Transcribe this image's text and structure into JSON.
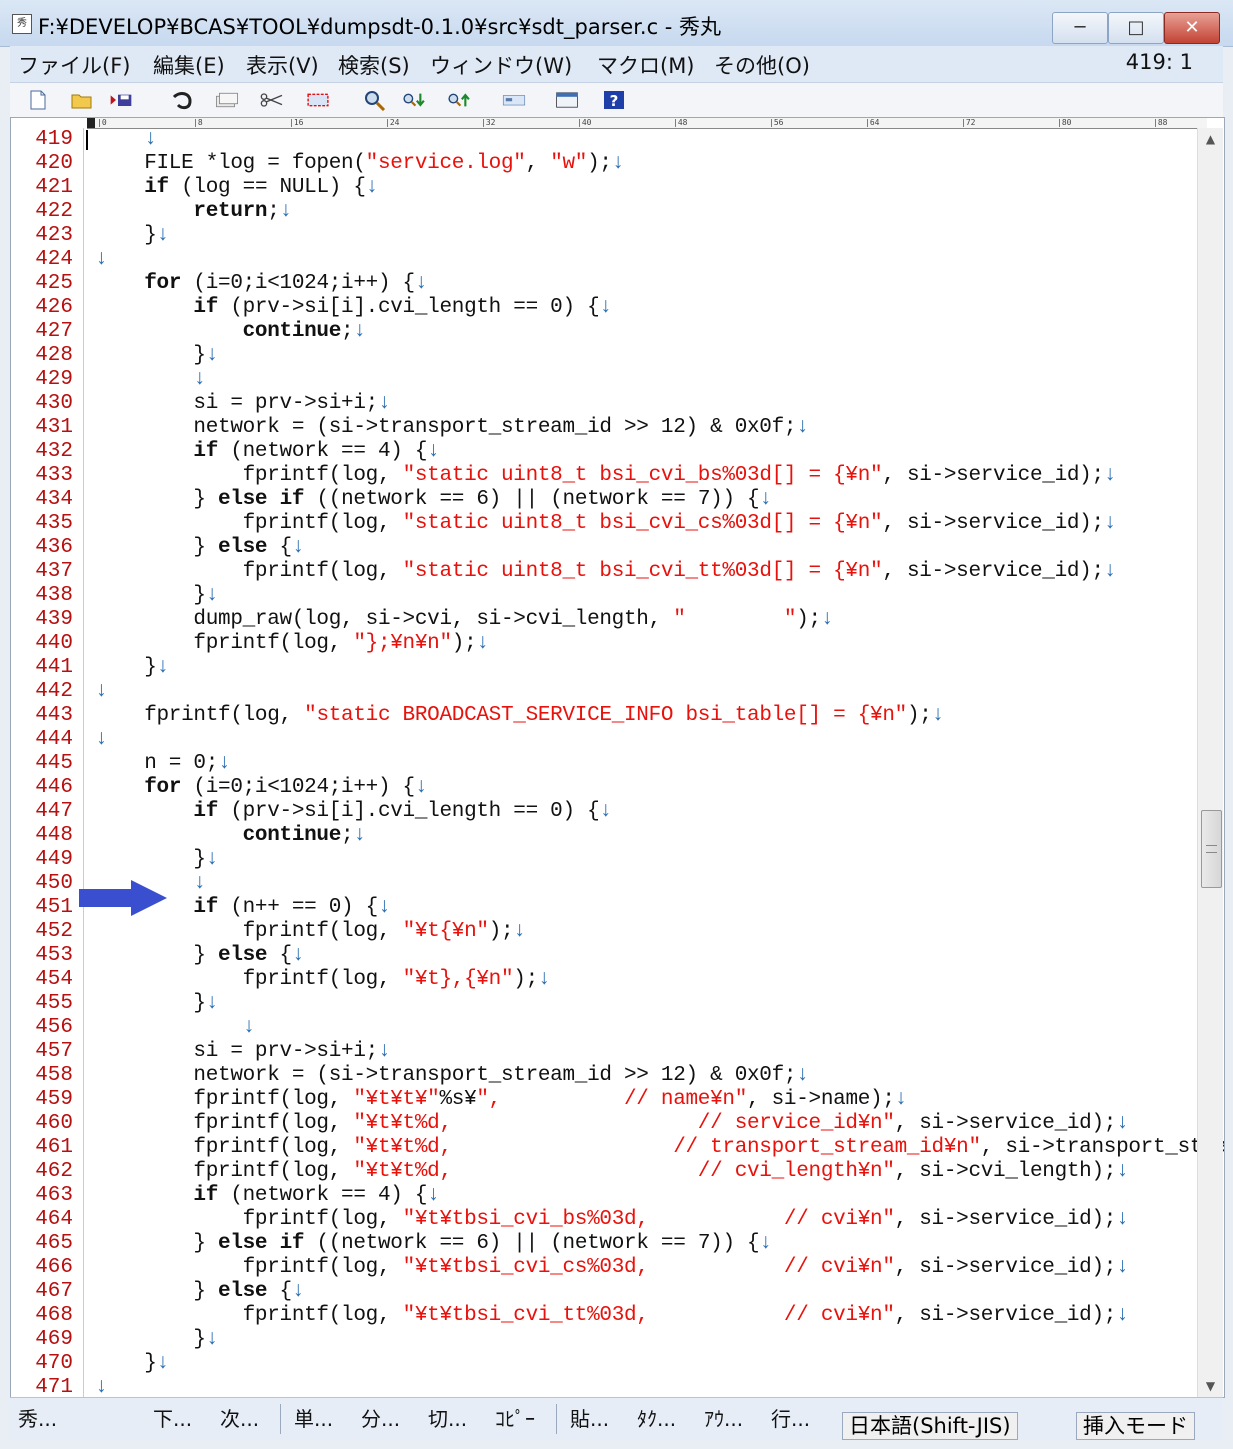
{
  "window": {
    "title": "F:¥DEVELOP¥BCAS¥TOOL¥dumpsdt-0.1.0¥src¥sdt_parser.c  - 秀丸",
    "app_icon_text": "秀",
    "minimize_glyph": "─",
    "maximize_glyph": "□",
    "close_glyph": "✕"
  },
  "menu": {
    "items": [
      "ファイル(F)",
      "編集(E)",
      "表示(V)",
      "検索(S)",
      "ウィンドウ(W)",
      "マクロ(M)",
      "その他(O)"
    ],
    "cursor_position": "419: 1"
  },
  "toolbar": {
    "icons": [
      "new-file-icon",
      "open-folder-icon",
      "save-icon",
      "undo-icon",
      "copy-icon",
      "cut-icon",
      "select-icon",
      "search-icon",
      "search-down-icon",
      "search-up-icon",
      "grep-icon",
      "window-icon",
      "help-icon"
    ]
  },
  "ruler": {
    "marks": [
      "0",
      "8",
      "16",
      "24",
      "32",
      "40",
      "48",
      "56",
      "64",
      "72",
      "80",
      "88"
    ]
  },
  "editor": {
    "lines": [
      {
        "n": "419",
        "t": "    ↓"
      },
      {
        "n": "420",
        "t": "    FILE *log = fopen(\"service.log\", \"w\");↓"
      },
      {
        "n": "421",
        "t": "    if (log == NULL) {↓"
      },
      {
        "n": "422",
        "t": "        return;↓"
      },
      {
        "n": "423",
        "t": "    }↓"
      },
      {
        "n": "424",
        "t": "↓"
      },
      {
        "n": "425",
        "t": "    for (i=0;i<1024;i++) {↓"
      },
      {
        "n": "426",
        "t": "        if (prv->si[i].cvi_length == 0) {↓"
      },
      {
        "n": "427",
        "t": "            continue;↓"
      },
      {
        "n": "428",
        "t": "        }↓"
      },
      {
        "n": "429",
        "t": "        ↓"
      },
      {
        "n": "430",
        "t": "        si = prv->si+i;↓"
      },
      {
        "n": "431",
        "t": "        network = (si->transport_stream_id >> 12) & 0x0f;↓"
      },
      {
        "n": "432",
        "t": "        if (network == 4) {↓"
      },
      {
        "n": "433",
        "t": "            fprintf(log, \"static uint8_t bsi_cvi_bs%03d[] = {¥n\", si->service_id);↓"
      },
      {
        "n": "434",
        "t": "        } else if ((network == 6) || (network == 7)) {↓"
      },
      {
        "n": "435",
        "t": "            fprintf(log, \"static uint8_t bsi_cvi_cs%03d[] = {¥n\", si->service_id);↓"
      },
      {
        "n": "436",
        "t": "        } else {↓"
      },
      {
        "n": "437",
        "t": "            fprintf(log, \"static uint8_t bsi_cvi_tt%03d[] = {¥n\", si->service_id);↓"
      },
      {
        "n": "438",
        "t": "        }↓"
      },
      {
        "n": "439",
        "t": "        dump_raw(log, si->cvi, si->cvi_length, \"        \");↓"
      },
      {
        "n": "440",
        "t": "        fprintf(log, \"};¥n¥n\");↓"
      },
      {
        "n": "441",
        "t": "    }↓"
      },
      {
        "n": "442",
        "t": "↓"
      },
      {
        "n": "443",
        "t": "    fprintf(log, \"static BROADCAST_SERVICE_INFO bsi_table[] = {¥n\");↓"
      },
      {
        "n": "444",
        "t": "↓"
      },
      {
        "n": "445",
        "t": "    n = 0;↓"
      },
      {
        "n": "446",
        "t": "    for (i=0;i<1024;i++) {↓"
      },
      {
        "n": "447",
        "t": "        if (prv->si[i].cvi_length == 0) {↓"
      },
      {
        "n": "448",
        "t": "            continue;↓"
      },
      {
        "n": "449",
        "t": "        }↓"
      },
      {
        "n": "450",
        "t": "        ↓"
      },
      {
        "n": "451",
        "t": "        if (n++ == 0) {↓"
      },
      {
        "n": "452",
        "t": "            fprintf(log, \"¥t{¥n\");↓"
      },
      {
        "n": "453",
        "t": "        } else {↓"
      },
      {
        "n": "454",
        "t": "            fprintf(log, \"¥t},{¥n\");↓"
      },
      {
        "n": "455",
        "t": "        }↓"
      },
      {
        "n": "456",
        "t": "            ↓"
      },
      {
        "n": "457",
        "t": "        si = prv->si+i;↓"
      },
      {
        "n": "458",
        "t": "        network = (si->transport_stream_id >> 12) & 0x0f;↓"
      },
      {
        "n": "459",
        "t": "        fprintf(log, \"¥t¥t¥\"%s¥\",          // name¥n\", si->name);↓"
      },
      {
        "n": "460",
        "t": "        fprintf(log, \"¥t¥t%d,                    // service_id¥n\", si->service_id);↓"
      },
      {
        "n": "461",
        "t": "        fprintf(log, \"¥t¥t%d,                  // transport_stream_id¥n\", si->transport_stre"
      },
      {
        "n": "462",
        "t": "        fprintf(log, \"¥t¥t%d,                    // cvi_length¥n\", si->cvi_length);↓"
      },
      {
        "n": "463",
        "t": "        if (network == 4) {↓"
      },
      {
        "n": "464",
        "t": "            fprintf(log, \"¥t¥tbsi_cvi_bs%03d,           // cvi¥n\", si->service_id);↓"
      },
      {
        "n": "465",
        "t": "        } else if ((network == 6) || (network == 7)) {↓"
      },
      {
        "n": "466",
        "t": "            fprintf(log, \"¥t¥tbsi_cvi_cs%03d,           // cvi¥n\", si->service_id);↓"
      },
      {
        "n": "467",
        "t": "        } else {↓"
      },
      {
        "n": "468",
        "t": "            fprintf(log, \"¥t¥tbsi_cvi_tt%03d,           // cvi¥n\", si->service_id);↓"
      },
      {
        "n": "469",
        "t": "        }↓"
      },
      {
        "n": "470",
        "t": "    }↓"
      },
      {
        "n": "471",
        "t": "↓"
      }
    ]
  },
  "statusbar": {
    "buttons": [
      "秀...",
      "下...",
      "次...",
      "単...",
      "分...",
      "切...",
      "ｺﾋﾟｰ",
      "貼...",
      "ﾀｸ...",
      "ｱｳ...",
      "行..."
    ],
    "encoding": "日本語(Shift-JIS)",
    "mode": "挿入モード"
  },
  "colors": {
    "keyword": "#000000",
    "string": "#e8120c",
    "line_number": "#b80f0f",
    "arrow_marker": "#3a4fd0"
  }
}
